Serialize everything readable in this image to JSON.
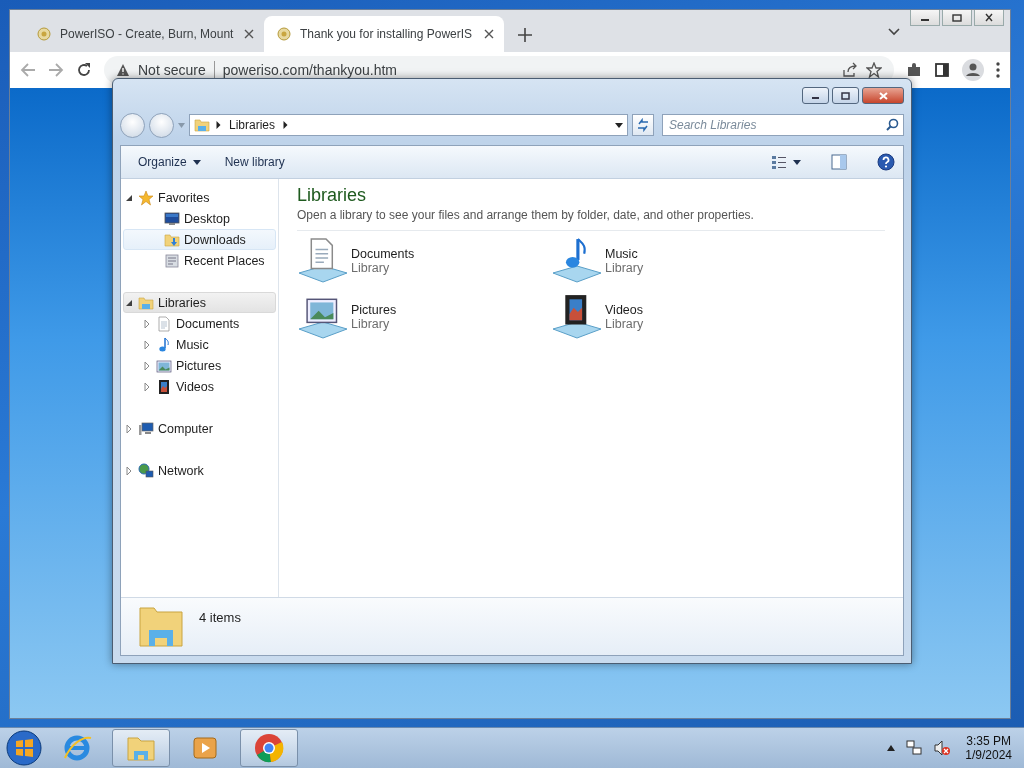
{
  "browser": {
    "tabs": [
      {
        "title": "PowerISO - Create, Burn, Mount",
        "selected": false
      },
      {
        "title": "Thank you for installing PowerIS",
        "selected": true
      }
    ],
    "security": "Not secure",
    "url": "poweriso.com/thankyou.htm"
  },
  "explorer": {
    "breadcrumb": [
      "Libraries"
    ],
    "search": {
      "placeholder": "Search Libraries"
    },
    "toolbar": [
      {
        "label": "Organize",
        "dropdown": true
      },
      {
        "label": "New library",
        "dropdown": false
      }
    ],
    "nav": [
      {
        "label": "Favorites",
        "kind": "favorites",
        "expanded": true,
        "selected": false,
        "hovered": false,
        "children": [
          {
            "label": "Desktop",
            "kind": "desktop",
            "selected": false,
            "hovered": false
          },
          {
            "label": "Downloads",
            "kind": "downloads",
            "selected": false,
            "hovered": true
          },
          {
            "label": "Recent Places",
            "kind": "recent",
            "selected": false,
            "hovered": false
          }
        ]
      },
      {
        "label": "Libraries",
        "kind": "libraries",
        "expanded": true,
        "selected": true,
        "hovered": false,
        "children": [
          {
            "label": "Documents",
            "kind": "documents",
            "expanded": false,
            "selected": false,
            "hovered": false
          },
          {
            "label": "Music",
            "kind": "music",
            "expanded": false,
            "selected": false,
            "hovered": false
          },
          {
            "label": "Pictures",
            "kind": "pictures",
            "expanded": false,
            "selected": false,
            "hovered": false
          },
          {
            "label": "Videos",
            "kind": "videos",
            "expanded": false,
            "selected": false,
            "hovered": false
          }
        ]
      },
      {
        "label": "Computer",
        "kind": "computer",
        "expanded": false,
        "selected": false,
        "hovered": false
      },
      {
        "label": "Network",
        "kind": "network",
        "expanded": false,
        "selected": false,
        "hovered": false
      }
    ],
    "content": {
      "title": "Libraries",
      "description": "Open a library to see your files and arrange them by folder, date, and other properties."
    },
    "libraries": [
      {
        "name": "Documents",
        "type": "Library",
        "kind": "documents"
      },
      {
        "name": "Music",
        "type": "Library",
        "kind": "music"
      },
      {
        "name": "Pictures",
        "type": "Library",
        "kind": "pictures"
      },
      {
        "name": "Videos",
        "type": "Library",
        "kind": "videos"
      }
    ],
    "status": "4 items"
  },
  "taskbar": {
    "apps": [
      {
        "kind": "ie",
        "running": false
      },
      {
        "kind": "explorer",
        "running": true
      },
      {
        "kind": "media",
        "running": false
      },
      {
        "kind": "chrome",
        "running": true
      }
    ],
    "clock": {
      "time": "3:35 PM",
      "date": "1/9/2024"
    }
  }
}
